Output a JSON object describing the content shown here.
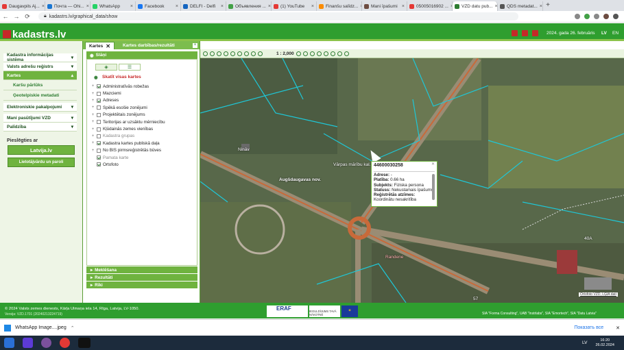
{
  "browser": {
    "tabs": [
      {
        "label": "Daugavpils Aj...",
        "color": "#e53935"
      },
      {
        "label": "Почта — Ohi...",
        "color": "#1976d2"
      },
      {
        "label": "WhatsApp",
        "color": "#25d366"
      },
      {
        "label": "Facebook",
        "color": "#1877f2"
      },
      {
        "label": "DELFI - Delfi",
        "color": "#1565c0"
      },
      {
        "label": "Объявления ...",
        "color": "#43a047"
      },
      {
        "label": "(1) YouTube",
        "color": "#e53935"
      },
      {
        "label": "Finanšu salīdz...",
        "color": "#fb8c00"
      },
      {
        "label": "Mani īpašumi",
        "color": "#6d4c41"
      },
      {
        "label": "05005016902 ...",
        "color": "#e53935"
      },
      {
        "label": "VZD datu pub...",
        "color": "#2e7d32"
      },
      {
        "label": "QDS metadat...",
        "color": "#555555"
      }
    ],
    "active_tab": 10,
    "url": "kadastrs.lv/graphical_data/show"
  },
  "header": {
    "logo": "kadastrs.lv",
    "date": "2024. gada 26. februāris",
    "lang_lv": "LV",
    "lang_en": "EN"
  },
  "left_menu": {
    "items": [
      {
        "label": "Kadastra informācijas sistēma",
        "arrow": "▾",
        "type": "menu"
      },
      {
        "label": "Valsts adrešu reģistrs",
        "arrow": "▾",
        "type": "menu"
      },
      {
        "label": "Kartes",
        "arrow": "▴",
        "type": "sub"
      },
      {
        "label": "Karšu pārlūks",
        "arrow": "",
        "type": "subsub"
      },
      {
        "label": "Ģeotelpiskie metadati",
        "arrow": "",
        "type": "subsub"
      },
      {
        "label": "Elektroniskie pakalpojumi",
        "arrow": "▾",
        "type": "menu"
      },
      {
        "label": "Mani pasūtījumi VZD",
        "arrow": "▾",
        "type": "menu"
      },
      {
        "label": "Palīdzība",
        "arrow": "▾",
        "type": "menu"
      }
    ],
    "login_title": "Pieslēgties ar",
    "login_latvija": "Latvija.lv",
    "login_user": "Lietotājvārdu un paroli"
  },
  "panel": {
    "tab_label": "Kartes",
    "title": "Kartes darbības/rezultāti",
    "slani": "Slāņi",
    "view_all": "Skatīt visas kartes",
    "layers": [
      {
        "label": "Administratīvās robežas",
        "checked": true,
        "grey": false
      },
      {
        "label": "Mazciemi",
        "checked": false,
        "grey": false
      },
      {
        "label": "Adreses",
        "checked": true,
        "grey": false
      },
      {
        "label": "Spēkā esošie zonējumi",
        "checked": false,
        "grey": false
      },
      {
        "label": "Projektētais zonējums",
        "checked": false,
        "grey": false
      },
      {
        "label": "Teritorijas ar uzsāktu mērniecību",
        "checked": false,
        "grey": false
      },
      {
        "label": "Kļūdainās zemes vienības",
        "checked": false,
        "grey": false
      },
      {
        "label": "Kadastra grupas",
        "checked": false,
        "grey": true
      },
      {
        "label": "Kadastra kartes publiskā daļa",
        "checked": true,
        "grey": false
      },
      {
        "label": "No BIS pirmsreģistrētās būves",
        "checked": false,
        "grey": false
      },
      {
        "label": "Pamata karte",
        "checked": true,
        "grey": true
      },
      {
        "label": "Ortofoto",
        "checked": true,
        "grey": false
      }
    ],
    "accordion": [
      "Meklēšana",
      "Rezultāti",
      "Rīki"
    ]
  },
  "map": {
    "scale": "1 : 2,000",
    "labels": {
      "varpas": "Vārpas mārību kal...",
      "augsdaug": "Augšdaugavas nov.",
      "randene": "Randene",
      "label40a": "40A",
      "label57": "57",
      "ninas": "Nināv",
      "copyright": "Ortofoto VZD, LĢIA dati"
    },
    "popup": {
      "id": "44600030258",
      "adrese_label": "Adrese:",
      "adrese": "-",
      "platiba_label": "Platība:",
      "platiba": "0.66 ha",
      "subjekts_label": "Subjekts:",
      "subjekts": "Fiziska persona",
      "statuss_label": "Statuss:",
      "statuss": "Nekustamais īpašums",
      "atzimes_label": "Reģistrētās atzīmes:",
      "atzimes": "Koordinātu nesakritība"
    }
  },
  "footer": {
    "copyright": "© 2024 Valsts zemes dienests, Kārļa Ulmaņa iela 14, Rīga, Latvija, LV-1050.",
    "version": "Versija: VZD.1701 (20240213224719)",
    "erdf": "ERAF",
    "invest": "IEGULDĪJUMS TAVĀ NĀKOTNĒ",
    "partners": "SIA \"Forma Consulting\", UAB \"Instrlabs\", SIA \"Emortech\", SIA \"Datu Latvia\""
  },
  "download": {
    "file": "WhatsApp Image....jpeg",
    "show_all": "Показать все"
  },
  "taskbar": {
    "lang": "LV",
    "time": "16:20",
    "date": "26.02.2024"
  }
}
